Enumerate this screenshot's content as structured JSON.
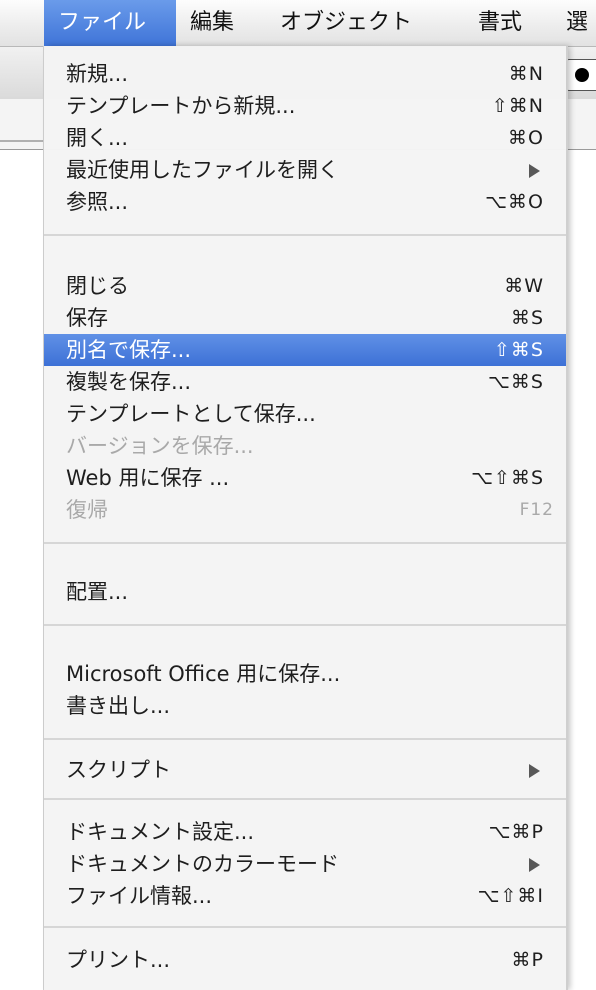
{
  "menubar": {
    "items": [
      {
        "label": "ファイル",
        "active": true
      },
      {
        "label": "編集"
      },
      {
        "label": "オブジェクト"
      },
      {
        "label": "書式"
      },
      {
        "label": "選"
      }
    ]
  },
  "menu": {
    "items": [
      {
        "label": "新規...",
        "shortcut": "⌘N"
      },
      {
        "label": "テンプレートから新規...",
        "shortcut": "⇧⌘N"
      },
      {
        "label": "開く...",
        "shortcut": "⌘O"
      },
      {
        "label": "最近使用したファイルを開く",
        "submenu": true
      },
      {
        "label": "参照...",
        "shortcut": "⌥⌘O"
      },
      {
        "label": "閉じる",
        "shortcut": "⌘W"
      },
      {
        "label": "保存",
        "shortcut": "⌘S"
      },
      {
        "label": "別名で保存...",
        "shortcut": "⇧⌘S",
        "highlighted": true
      },
      {
        "label": "複製を保存...",
        "shortcut": "⌥⌘S"
      },
      {
        "label": "テンプレートとして保存..."
      },
      {
        "label": "バージョンを保存...",
        "disabled": true
      },
      {
        "label": "Web 用に保存 ...",
        "shortcut": "⌥⇧⌘S"
      },
      {
        "label": "復帰",
        "shortcut": "F12",
        "disabled": true
      },
      {
        "label": "配置..."
      },
      {
        "label": "Microsoft Office 用に保存..."
      },
      {
        "label": "書き出し..."
      },
      {
        "label": "スクリプト",
        "submenu": true
      },
      {
        "label": "ドキュメント設定...",
        "shortcut": "⌥⌘P"
      },
      {
        "label": "ドキュメントのカラーモード",
        "submenu": true
      },
      {
        "label": "ファイル情報...",
        "shortcut": "⌥⇧⌘I"
      },
      {
        "label": "プリント...",
        "shortcut": "⌘P"
      }
    ]
  },
  "colors": {
    "highlight": "#3f74d8",
    "disabled_text": "#a8a8a8",
    "menu_background": "#f4f4f4"
  }
}
